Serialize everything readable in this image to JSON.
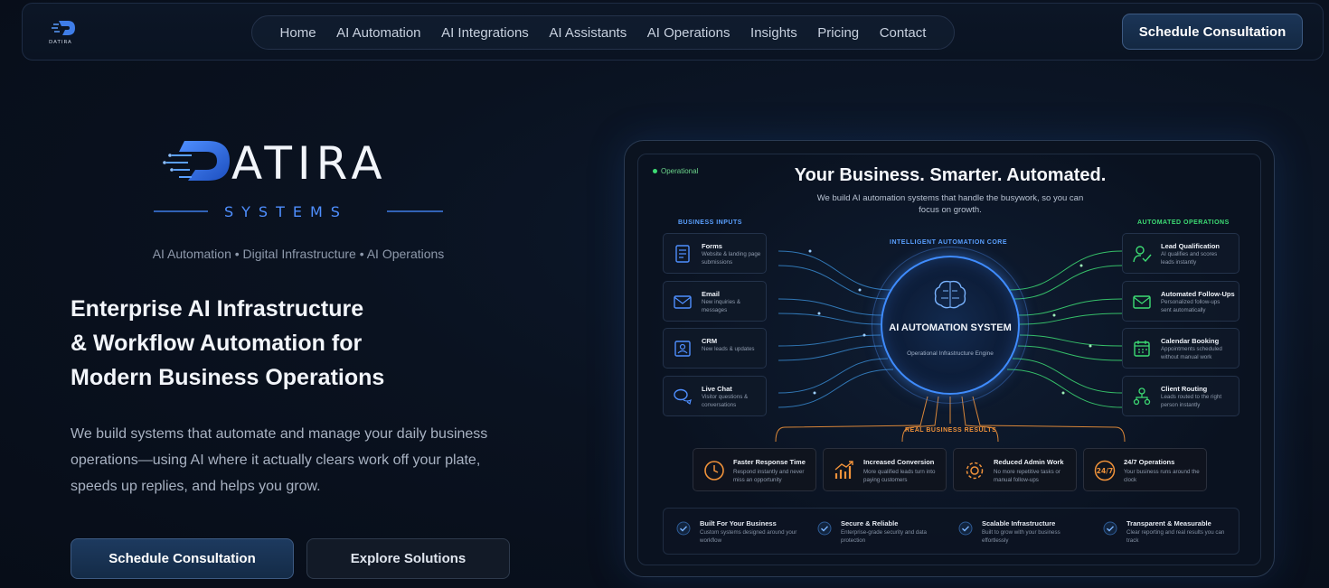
{
  "header": {
    "logo_text": "DATIRA",
    "nav": [
      "Home",
      "AI Automation",
      "AI Integrations",
      "AI Assistants",
      "AI Operations",
      "Insights",
      "Pricing",
      "Contact"
    ],
    "cta_label": "Schedule Consultation"
  },
  "hero": {
    "brand_name": "ATIRA",
    "brand_sub": "SYSTEMS",
    "tagline": "AI Automation • Digital Infrastructure • AI Operations",
    "headline": [
      "Enterprise AI Infrastructure",
      "& Workflow Automation for",
      "Modern Business Operations"
    ],
    "description": "We build systems that automate and manage your daily business operations—using AI where it actually clears work off your plate, speeds up replies, and helps you grow.",
    "primary_button": "Schedule Consultation",
    "secondary_button": "Explore Solutions"
  },
  "panel": {
    "status": "Operational",
    "title": "Your Business. Smarter. Automated.",
    "subtitle": "We build AI automation systems that handle the busywork, so you can focus on growth.",
    "inputs_label": "BUSINESS INPUTS",
    "core_label": "INTELLIGENT AUTOMATION CORE",
    "ops_label": "AUTOMATED OPERATIONS",
    "results_label": "REAL BUSINESS RESULTS",
    "core_title": "AI AUTOMATION SYSTEM",
    "core_subtitle": "Operational Infrastructure Engine",
    "inputs": [
      {
        "title": "Forms",
        "desc": "Website & landing page submissions",
        "icon": "form-icon"
      },
      {
        "title": "Email",
        "desc": "New inquiries & messages",
        "icon": "email-icon"
      },
      {
        "title": "CRM",
        "desc": "New leads & updates",
        "icon": "crm-icon"
      },
      {
        "title": "Live Chat",
        "desc": "Visitor questions & conversations",
        "icon": "chat-icon"
      }
    ],
    "operations": [
      {
        "title": "Lead Qualification",
        "desc": "AI qualifies and scores leads instantly",
        "icon": "user-check-icon"
      },
      {
        "title": "Automated Follow-Ups",
        "desc": "Personalized follow-ups sent automatically",
        "icon": "mail-send-icon"
      },
      {
        "title": "Calendar Booking",
        "desc": "Appointments scheduled without manual work",
        "icon": "calendar-icon"
      },
      {
        "title": "Client Routing",
        "desc": "Leads routed to the right person instantly",
        "icon": "routing-icon"
      }
    ],
    "results": [
      {
        "title": "Faster Response Time",
        "desc": "Respond instantly and never miss an opportunity",
        "icon": "clock-icon"
      },
      {
        "title": "Increased Conversion",
        "desc": "More qualified leads turn into paying customers",
        "icon": "growth-chart-icon"
      },
      {
        "title": "Reduced Admin Work",
        "desc": "No more repetitive tasks or manual follow-ups",
        "icon": "gear-icon"
      },
      {
        "title": "24/7 Operations",
        "desc": "Your business runs around the clock",
        "icon": "24-7-icon"
      }
    ],
    "features": [
      {
        "title": "Built For Your Business",
        "desc": "Custom systems designed around your workflow"
      },
      {
        "title": "Secure & Reliable",
        "desc": "Enterprise-grade security and data protection"
      },
      {
        "title": "Scalable Infrastructure",
        "desc": "Built to grow with your business effortlessly"
      },
      {
        "title": "Transparent & Measurable",
        "desc": "Clear reporting and real results you can track"
      }
    ]
  },
  "colors": {
    "accent_blue": "#3f8cff",
    "accent_green": "#3ddc74",
    "accent_orange": "#f0923a",
    "background": "#0a1220"
  }
}
